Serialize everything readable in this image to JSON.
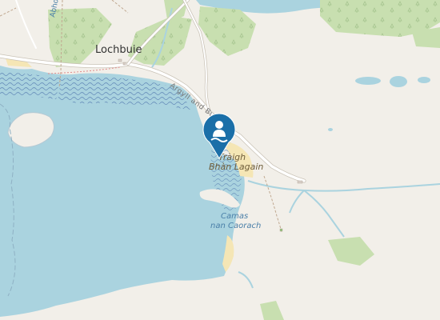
{
  "map": {
    "labels": {
      "settlement": "Lochbuie",
      "beach_line1": "Tràigh",
      "beach_line2": "Bhàn Lagain",
      "bay_line1": "Camas",
      "bay_line2": "nan Caorach",
      "road": "Argyll and Bute",
      "track": "Abho"
    },
    "marker": {
      "icon": "swimming-icon",
      "color": "#1b6fa8"
    },
    "colors": {
      "land": "#f2efe9",
      "sea": "#aad3df",
      "wood": "#c8dfb0",
      "wetland": "#7a9ec0",
      "sand": "#f5e6b5",
      "river": "#aad3df",
      "road": "#ffffff"
    }
  }
}
